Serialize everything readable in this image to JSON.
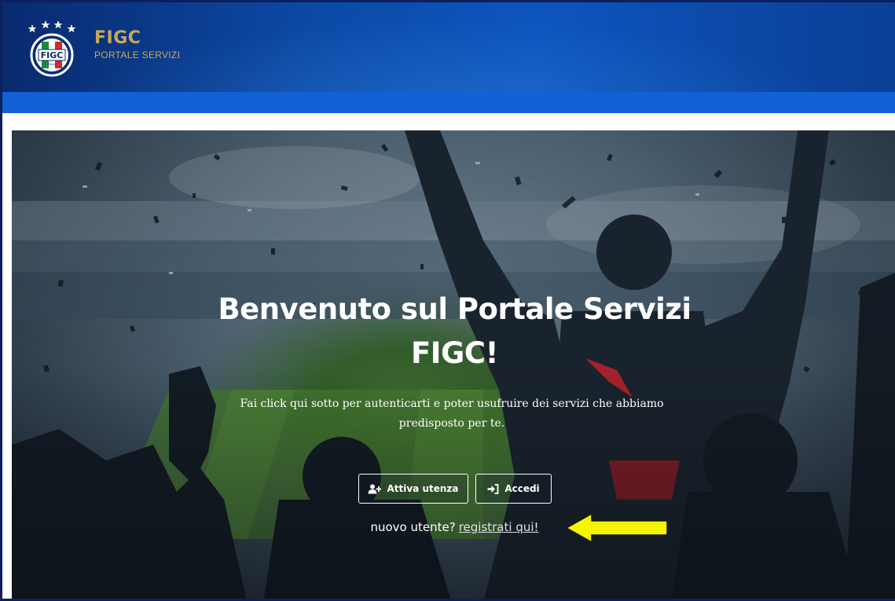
{
  "header": {
    "brand_name": "FIGC",
    "brand_subtitle": "PORTALE SERVIZI",
    "logo_text": "FIGC",
    "logo_small_text": "ITALIA"
  },
  "hero": {
    "title_line1": "Benvenuto sul Portale Servizi",
    "title_line2": "FIGC!",
    "description": "Fai click qui sotto per autenticarti e poter usufruire dei servizi che abbiamo predisposto per te.",
    "activate_button_label": "Attiva utenza",
    "login_button_label": "Accedi",
    "register_prefix": "nuovo utente?",
    "register_link_label": "registrati qui!"
  },
  "colors": {
    "header_blue": "#0b4aa6",
    "subbar_blue": "#1160d6",
    "brand_gold": "#c8a95a",
    "arrow_yellow": "#f5f500"
  },
  "icons": {
    "activate_button": "user-plus-icon",
    "login_button": "sign-in-icon",
    "annotation": "yellow-arrow-left-icon"
  }
}
